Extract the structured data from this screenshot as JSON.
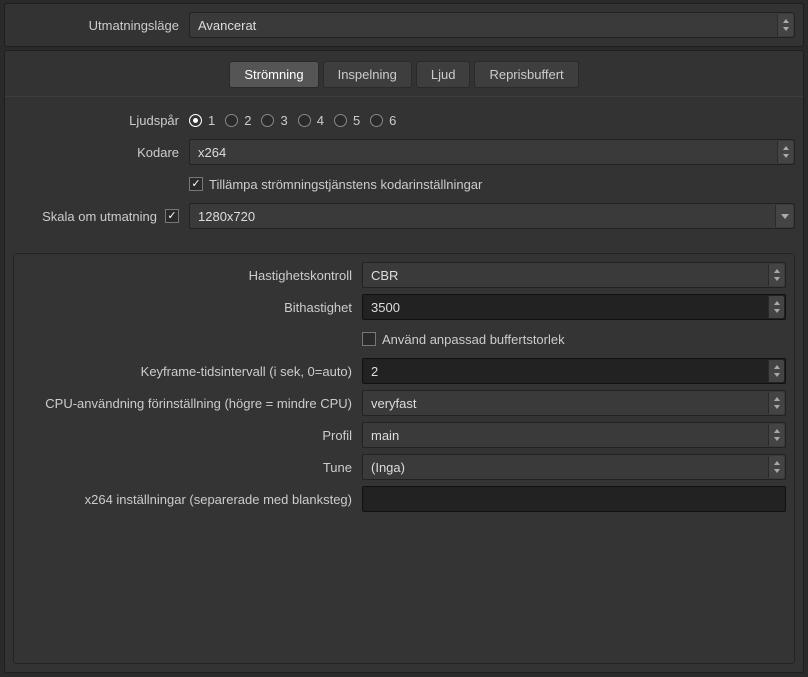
{
  "top": {
    "mode_label": "Utmatningsläge",
    "mode_value": "Avancerat"
  },
  "tabs": [
    "Strömning",
    "Inspelning",
    "Ljud",
    "Reprisbuffert"
  ],
  "active_tab": 0,
  "upper": {
    "audio_tracks_label": "Ljudspår",
    "audio_tracks": [
      "1",
      "2",
      "3",
      "4",
      "5",
      "6"
    ],
    "audio_selected": 0,
    "encoder_label": "Kodare",
    "encoder_value": "x264",
    "apply_service_label": "Tillämpa strömningstjänstens kodarinställningar",
    "apply_service_checked": true,
    "rescale_label": "Skala om utmatning",
    "rescale_checked": true,
    "rescale_value": "1280x720"
  },
  "encoder": {
    "rate_control_label": "Hastighetskontroll",
    "rate_control_value": "CBR",
    "bitrate_label": "Bithastighet",
    "bitrate_value": "3500",
    "custom_buffer_label": "Använd anpassad buffertstorlek",
    "custom_buffer_checked": false,
    "keyframe_label": "Keyframe-tidsintervall (i sek, 0=auto)",
    "keyframe_value": "2",
    "cpu_preset_label": "CPU-användning förinställning (högre = mindre CPU)",
    "cpu_preset_value": "veryfast",
    "profile_label": "Profil",
    "profile_value": "main",
    "tune_label": "Tune",
    "tune_value": "(Inga)",
    "x264opts_label": "x264 inställningar (separerade med blanksteg)",
    "x264opts_value": ""
  }
}
